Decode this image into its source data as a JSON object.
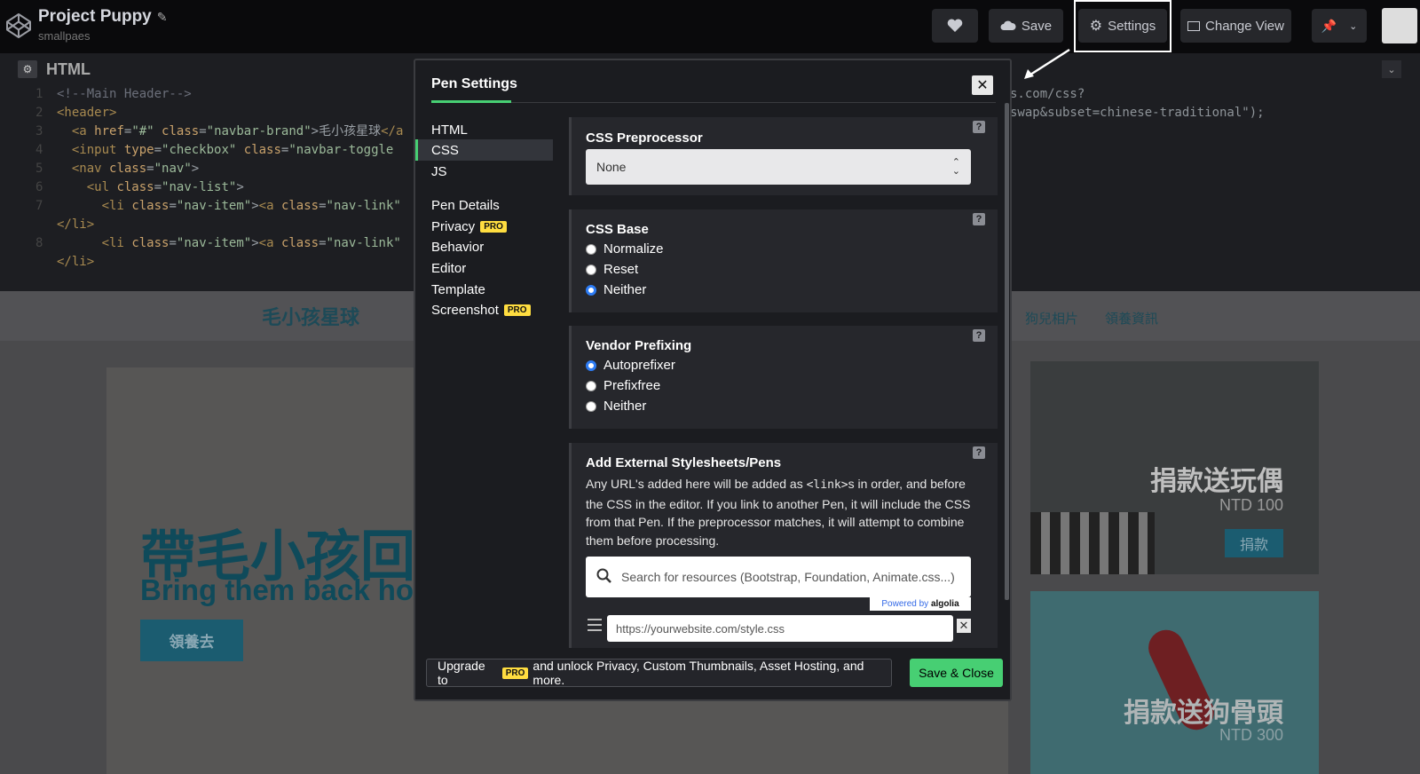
{
  "topbar": {
    "project_title": "Project Puppy",
    "username": "smallpaes",
    "save_label": "Save",
    "settings_label": "Settings",
    "change_view_label": "Change View"
  },
  "editor": {
    "title": "HTML",
    "lines": [
      {
        "n": "1",
        "html": "<span class='c'>&lt;!--Main Header--&gt;</span>"
      },
      {
        "n": "2",
        "html": "<span class='t'>&lt;header&gt;</span>"
      },
      {
        "n": "3",
        "html": "  <span class='t'>&lt;a</span> <span class='a'>href</span>=<span class='s'>\"#\"</span> <span class='a'>class</span>=<span class='s'>\"navbar-brand\"</span>&gt;毛小孩星球<span class='t'>&lt;/a</span>"
      },
      {
        "n": "4",
        "html": "  <span class='t'>&lt;input</span> <span class='a'>type</span>=<span class='s'>\"checkbox\"</span> <span class='a'>class</span>=<span class='s'>\"navbar-toggle</span>"
      },
      {
        "n": "5",
        "html": "  <span class='t'>&lt;nav</span> <span class='a'>class</span>=<span class='s'>\"nav\"</span>&gt;"
      },
      {
        "n": "6",
        "html": "    <span class='t'>&lt;ul</span> <span class='a'>class</span>=<span class='s'>\"nav-list\"</span>&gt;"
      },
      {
        "n": "7",
        "html": "      <span class='t'>&lt;li</span> <span class='a'>class</span>=<span class='s'>\"nav-item\"</span>&gt;<span class='t'>&lt;a</span> <span class='a'>class</span>=<span class='s'>\"nav-link\"</span>"
      },
      {
        "n": "",
        "html": "<span class='t'>&lt;/li&gt;</span>"
      },
      {
        "n": "8",
        "html": "      <span class='t'>&lt;li</span> <span class='a'>class</span>=<span class='s'>\"nav-item\"</span>&gt;<span class='t'>&lt;a</span> <span class='a'>class</span>=<span class='s'>\"nav-link\"</span>"
      },
      {
        "n": "",
        "html": "<span class='t'>&lt;/li&gt;</span>"
      }
    ],
    "right_line1": "s.com/css?",
    "right_line2": "swap&subset=chinese-traditional\");"
  },
  "preview": {
    "brand": "毛小孩星球",
    "nav_links": [
      "狗兒相片",
      "領養資訊"
    ],
    "hero_title": "帶毛小孩回",
    "hero_subtitle": "Bring them back ho",
    "hero_button": "領養去",
    "card1_cta": "捐款送玩偶",
    "card1_price": "NTD 100",
    "card1_button": "捐款",
    "card2_cta": "捐款送狗骨頭",
    "card2_price": "NTD 300"
  },
  "modal": {
    "title": "Pen Settings",
    "close_label": "✕",
    "nav": [
      {
        "label": "HTML",
        "pro": false
      },
      {
        "label": "CSS",
        "pro": false
      },
      {
        "label": "JS",
        "pro": false
      },
      {
        "label": "Pen Details",
        "pro": false
      },
      {
        "label": "Privacy",
        "pro": true
      },
      {
        "label": "Behavior",
        "pro": false
      },
      {
        "label": "Editor",
        "pro": false
      },
      {
        "label": "Template",
        "pro": false
      },
      {
        "label": "Screenshot",
        "pro": true
      }
    ],
    "active_nav": "CSS",
    "pro_badge": "PRO",
    "preprocessor": {
      "heading": "CSS Preprocessor",
      "selected": "None"
    },
    "css_base": {
      "heading": "CSS Base",
      "options": [
        "Normalize",
        "Reset",
        "Neither"
      ],
      "selected": "Neither"
    },
    "vendor_prefixing": {
      "heading": "Vendor Prefixing",
      "options": [
        "Autoprefixer",
        "Prefixfree",
        "Neither"
      ],
      "selected": "Autoprefixer"
    },
    "external": {
      "heading": "Add External Stylesheets/Pens",
      "desc_before": "Any URL's added here will be added as ",
      "desc_code": "<link>",
      "desc_after": "s in order, and before the CSS in the editor. If you link to another Pen, it will include the CSS from that Pen. If the preprocessor matches, it will attempt to combine them before processing.",
      "search_placeholder": "Search for resources (Bootstrap, Foundation, Animate.css...)",
      "powered_by": "Powered by",
      "powered_brand": "algolia",
      "url_placeholder": "https://yourwebsite.com/style.css"
    },
    "help_label": "?",
    "upgrade_before": "Upgrade to",
    "upgrade_after": "and unlock Privacy, Custom Thumbnails, Asset Hosting, and more.",
    "save_close_label": "Save & Close"
  },
  "colors": {
    "accent_green": "#47cf73",
    "pro_yellow": "#ffdd40",
    "radio_blue": "#2d7cf5"
  }
}
